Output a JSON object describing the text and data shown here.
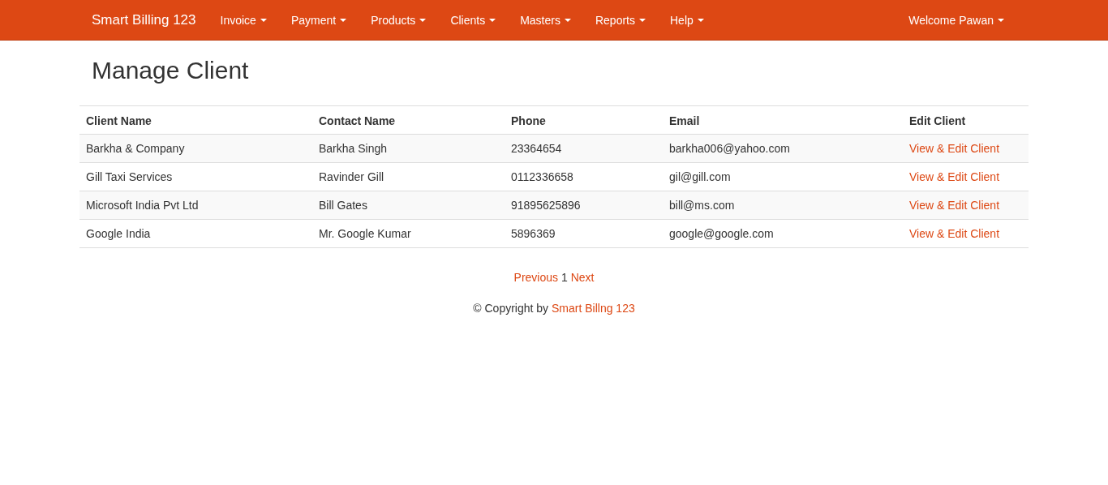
{
  "navbar": {
    "brand": "Smart Billing 123",
    "menus": [
      {
        "label": "Invoice"
      },
      {
        "label": "Payment"
      },
      {
        "label": "Products"
      },
      {
        "label": "Clients"
      },
      {
        "label": "Masters"
      },
      {
        "label": "Reports"
      },
      {
        "label": "Help"
      }
    ],
    "user_menu": {
      "label": "Welcome Pawan"
    }
  },
  "page_title": "Manage Client",
  "table": {
    "columns": [
      "Client Name",
      "Contact Name",
      "Phone",
      "Email",
      "Edit Client"
    ],
    "rows": [
      {
        "cells": [
          "Barkha & Company",
          "Barkha Singh",
          "23364654",
          "barkha006@yahoo.com"
        ],
        "link": "View & Edit Client"
      },
      {
        "cells": [
          "Gill Taxi Services",
          "Ravinder Gill",
          "0112336658",
          "gil@gill.com"
        ],
        "link": "View & Edit Client"
      },
      {
        "cells": [
          "Microsoft India Pvt Ltd",
          "Bill Gates",
          "91895625896",
          "bill@ms.com"
        ],
        "link": "View & Edit Client"
      },
      {
        "cells": [
          "Google India",
          "Mr. Google Kumar",
          "5896369",
          "google@google.com"
        ],
        "link": "View & Edit Client"
      }
    ]
  },
  "pagination": {
    "previous": "Previous",
    "page": "1",
    "next": "Next"
  },
  "footer": {
    "text": "© Copyright by",
    "link": "Smart Billng 123"
  }
}
